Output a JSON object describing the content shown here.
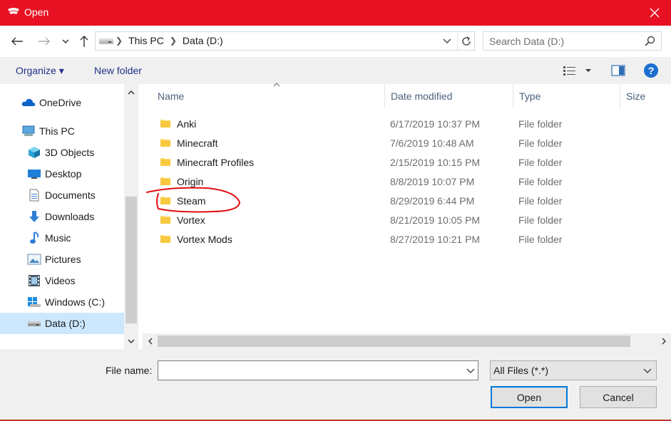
{
  "window": {
    "title": "Open",
    "accent_color": "#e81123"
  },
  "nav": {
    "back_icon": "arrow-left-icon",
    "forward_icon": "arrow-right-icon",
    "recent_icon": "chevron-down-icon",
    "up_icon": "arrow-up-icon"
  },
  "address": {
    "crumbs": [
      "This PC",
      "Data (D:)"
    ]
  },
  "search": {
    "placeholder": "Search Data (D:)"
  },
  "toolbar": {
    "organize_label": "Organize ▾",
    "new_folder_label": "New folder"
  },
  "sidebar": {
    "items": [
      {
        "label": "OneDrive",
        "icon": "cloud-icon"
      },
      {
        "label": "This PC",
        "icon": "computer-icon"
      },
      {
        "label": "3D Objects",
        "icon": "cube-icon"
      },
      {
        "label": "Desktop",
        "icon": "desktop-icon"
      },
      {
        "label": "Documents",
        "icon": "document-icon"
      },
      {
        "label": "Downloads",
        "icon": "download-icon"
      },
      {
        "label": "Music",
        "icon": "music-icon"
      },
      {
        "label": "Pictures",
        "icon": "picture-icon"
      },
      {
        "label": "Videos",
        "icon": "video-icon"
      },
      {
        "label": "Windows (C:)",
        "icon": "drive-icon"
      },
      {
        "label": "Data (D:)",
        "icon": "drive-icon"
      }
    ],
    "selected": "Data (D:)"
  },
  "columns": [
    "Name",
    "Date modified",
    "Type",
    "Size"
  ],
  "files": [
    {
      "name": "Anki",
      "date": "6/17/2019 10:37 PM",
      "type": "File folder"
    },
    {
      "name": "Minecraft",
      "date": "7/6/2019 10:48 AM",
      "type": "File folder"
    },
    {
      "name": "Minecraft Profiles",
      "date": "2/15/2019 10:15 PM",
      "type": "File folder"
    },
    {
      "name": "Origin",
      "date": "8/8/2019 10:07 PM",
      "type": "File folder"
    },
    {
      "name": "Steam",
      "date": "8/29/2019 6:44 PM",
      "type": "File folder"
    },
    {
      "name": "Vortex",
      "date": "8/21/2019 10:05 PM",
      "type": "File folder"
    },
    {
      "name": "Vortex Mods",
      "date": "8/27/2019 10:21 PM",
      "type": "File folder"
    }
  ],
  "footer": {
    "file_name_label": "File name:",
    "file_name_value": "",
    "filter_value": "All Files (*.*)",
    "open_label": "Open",
    "cancel_label": "Cancel"
  }
}
